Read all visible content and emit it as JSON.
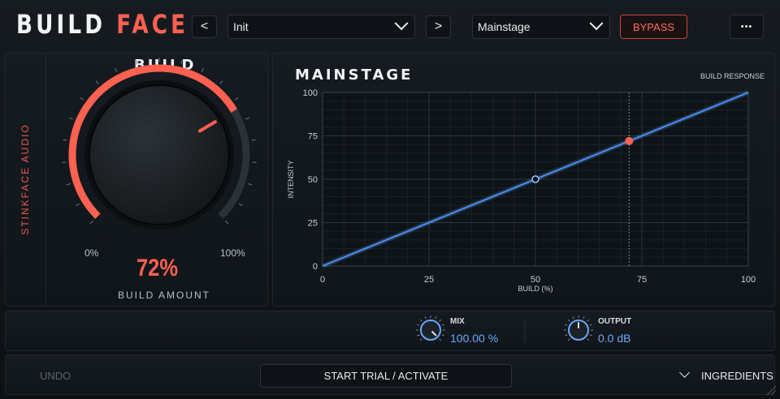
{
  "header": {
    "logo_part1": "BUILD",
    "logo_part2": "FACE",
    "prev_label": "<",
    "next_label": ">",
    "preset": "Init",
    "mode": "Mainstage",
    "bypass_label": "BYPASS",
    "more_label": "•••"
  },
  "left_panel": {
    "brand": "STINKFACE AUDIO",
    "title": "BUILD",
    "knob_min_label": "0%",
    "knob_max_label": "100%",
    "knob_value": "72%",
    "knob_fraction": 0.72,
    "caption": "BUILD AMOUNT"
  },
  "chart_panel": {
    "title": "MAINSTAGE",
    "subtitle": "BUILD RESPONSE"
  },
  "chart_data": {
    "type": "line",
    "title": "MAINSTAGE",
    "subtitle": "BUILD RESPONSE",
    "xlabel": "BUILD (%)",
    "ylabel": "INTENSITY",
    "xlim": [
      0,
      100
    ],
    "ylim": [
      0,
      100
    ],
    "x_ticks": [
      0,
      25,
      50,
      75,
      100
    ],
    "y_ticks": [
      0,
      25,
      50,
      75,
      100
    ],
    "grid": true,
    "series": [
      {
        "x": [
          0,
          100
        ],
        "y": [
          0,
          100
        ]
      }
    ],
    "marker_midpoint": {
      "x": 50,
      "y": 50
    },
    "marker_current": {
      "x": 72,
      "y": 72
    },
    "colors": {
      "line": "#4d8eea",
      "current": "#ff6150",
      "grid": "#22292f"
    }
  },
  "mix": {
    "label": "MIX",
    "value": "100.00 %",
    "fraction": 1.0
  },
  "output": {
    "label": "OUTPUT",
    "value": "0.0 dB",
    "fraction": 0.5
  },
  "footer": {
    "undo": "UNDO",
    "activate": "START TRIAL / ACTIVATE",
    "ingredients": "INGREDIENTS"
  },
  "colors": {
    "accent": "#ff6150",
    "blue": "#6aa8ff"
  }
}
